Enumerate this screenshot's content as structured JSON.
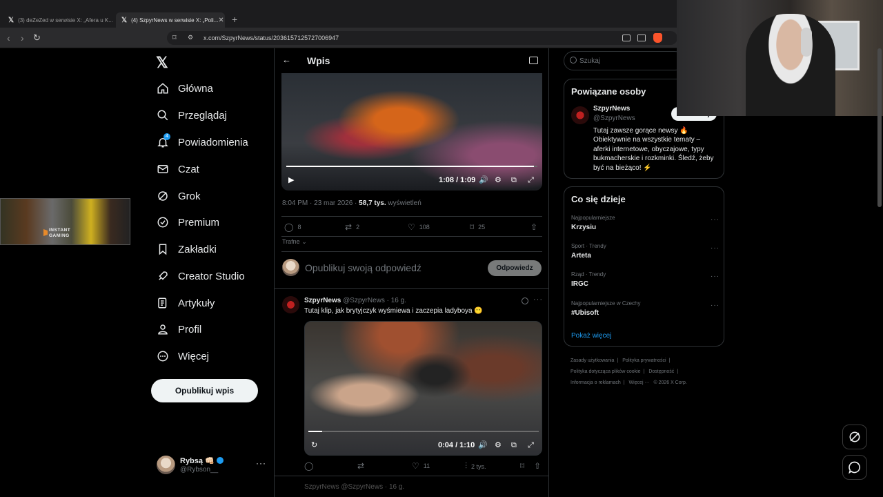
{
  "browser": {
    "tabs": [
      {
        "label": "(3) deZeZed w serwisie X: „Afera u K..."
      },
      {
        "label": "(4) SzpyrNews w serwisie X: „Poli..."
      }
    ],
    "new_tab": "+",
    "url": "x.com/SzpyrNews/status/2036157125727006947"
  },
  "nav": {
    "items": [
      {
        "label": "Główna",
        "icon": "home-icon"
      },
      {
        "label": "Przeglądaj",
        "icon": "search-icon"
      },
      {
        "label": "Powiadomienia",
        "icon": "bell-icon",
        "badge": "4"
      },
      {
        "label": "Czat",
        "icon": "mail-icon"
      },
      {
        "label": "Grok",
        "icon": "grok-icon"
      },
      {
        "label": "Premium",
        "icon": "premium-icon"
      },
      {
        "label": "Zakładki",
        "icon": "bookmark-icon"
      },
      {
        "label": "Creator Studio",
        "icon": "rocket-icon"
      },
      {
        "label": "Artykuły",
        "icon": "article-icon"
      },
      {
        "label": "Profil",
        "icon": "person-icon"
      },
      {
        "label": "Więcej",
        "icon": "more-circle-icon"
      }
    ],
    "post_button": "Opublikuj wpis",
    "user": {
      "name": "Rybsą 👊🏻",
      "handle": "@Rybson__"
    }
  },
  "ad": {
    "text_line1": "INSTANT",
    "text_line2": "GAMING"
  },
  "main": {
    "header_title": "Wpis",
    "video1": {
      "time": "1:08 / 1:09",
      "progress": 0.985
    },
    "meta": {
      "time": "8:04 PM · 23 mar 2026 · ",
      "views": "58,7 tys.",
      "views_label": " wyświetleń"
    },
    "actions": {
      "replies": "8",
      "reposts": "2",
      "likes": "108",
      "bookmarks": "25"
    },
    "sort": "Trafne",
    "reply": {
      "placeholder": "Opublikuj swoją odpowiedź",
      "button": "Odpowiedz"
    },
    "tweet2": {
      "name": "SzpyrNews",
      "handle": "@SzpyrNews · 16 g.",
      "text": "Tutaj klip, jak brytyjczyk wyśmiewa i zaczepia ladyboya 😶",
      "video_time": "0:04 / 1:10",
      "video_progress": 0.06,
      "likes": "11",
      "views": "2 tys."
    },
    "ghost": "SzpyrNews @SzpyrNews · 16 g."
  },
  "right": {
    "search_placeholder": "Szukaj",
    "related": {
      "title": "Powiązane osoby",
      "name": "SzpyrNews",
      "handle": "@SzpyrNews",
      "follow": "Obserwuj",
      "bio": "Tutaj zawsze gorące newsy 🔥 Obiektywnie na wszystkie tematy – aferki internetowe, obyczajowe, typy bukmacherskie i rozkminki. Śledź, żeby być na bieżąco! ⚡"
    },
    "trends": {
      "title": "Co się dzieje",
      "items": [
        {
          "context": "Najpopularniejsze",
          "name": "Krzysiu"
        },
        {
          "context": "Sport · Trendy",
          "name": "Arteta"
        },
        {
          "context": "Rząd · Trendy",
          "name": "IRGC"
        },
        {
          "context": "Najpopularniejsze w Czechy",
          "name": "#Ubisoft"
        }
      ],
      "show_more": "Pokaż więcej"
    },
    "footer": [
      "Zasady użytkowania",
      "|",
      "Polityka prywatności",
      "|",
      "Polityka dotycząca plików cookie",
      "|",
      "Dostępność",
      "|",
      "Informacja o reklamach",
      "|",
      "Więcej ···",
      "© 2026 X Corp."
    ]
  }
}
